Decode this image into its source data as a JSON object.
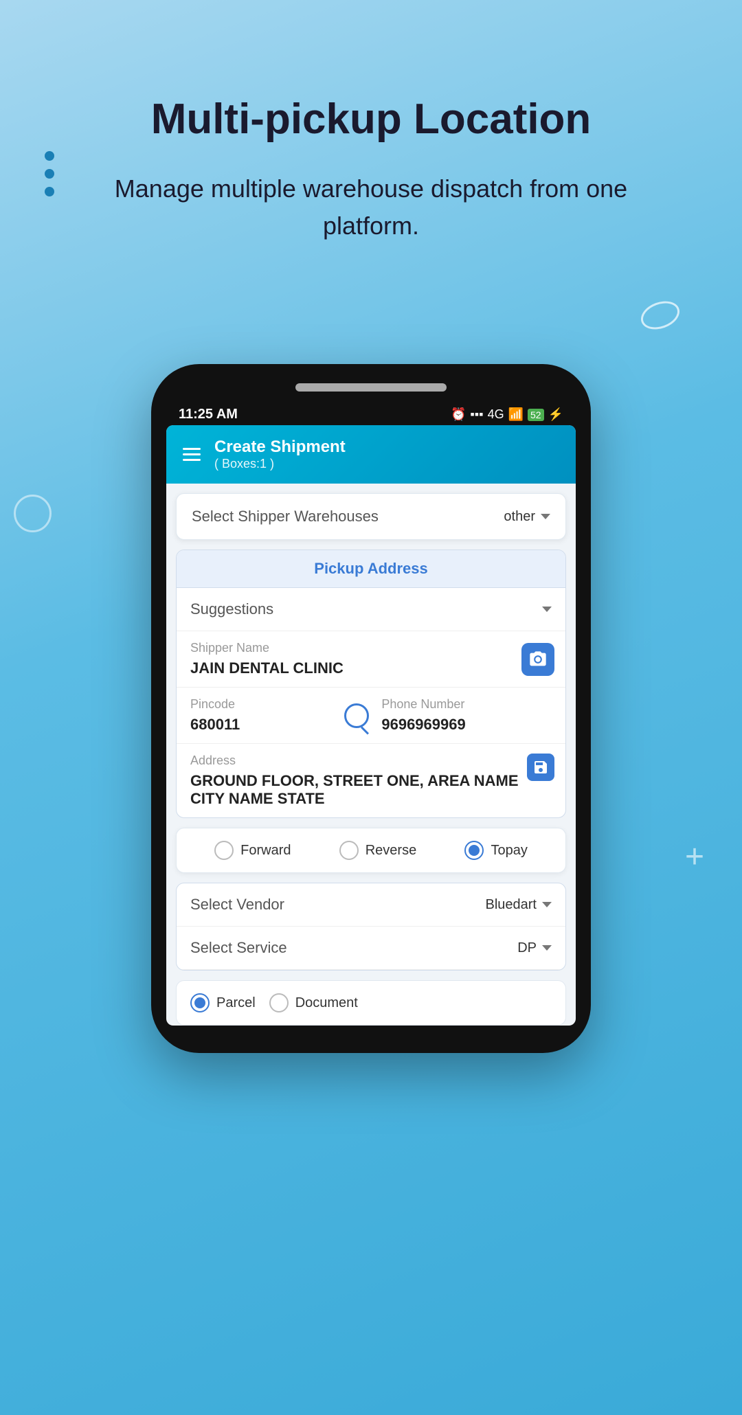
{
  "background": {
    "gradient_start": "#a8d8f0",
    "gradient_end": "#3aaad8"
  },
  "page": {
    "title": "Multi-pickup Location",
    "subtitle": "Manage multiple warehouse dispatch from one platform."
  },
  "phone": {
    "status_bar": {
      "time": "11:25 AM",
      "battery": "52",
      "signal": "4G"
    },
    "app_header": {
      "title": "Create Shipment",
      "subtitle": "( Boxes:1 )"
    },
    "warehouse_select": {
      "label": "Select Shipper Warehouses",
      "value": "other"
    },
    "pickup_section": {
      "header": "Pickup Address",
      "suggestions_label": "Suggestions",
      "shipper_name_label": "Shipper Name",
      "shipper_name_value": "JAIN DENTAL CLINIC",
      "pincode_label": "Pincode",
      "pincode_value": "680011",
      "phone_label": "Phone Number",
      "phone_value": "9696969969",
      "address_label": "Address",
      "address_value": "GROUND FLOOR, STREET ONE, AREA NAME CITY NAME STATE"
    },
    "shipment_types": [
      {
        "label": "Forward",
        "selected": false
      },
      {
        "label": "Reverse",
        "selected": false
      },
      {
        "label": "Topay",
        "selected": true
      }
    ],
    "vendor_section": {
      "vendor_label": "Select Vendor",
      "vendor_value": "Bluedart",
      "service_label": "Select Service",
      "service_value": "DP"
    },
    "parcel_types": [
      {
        "label": "Parcel",
        "selected": true
      },
      {
        "label": "Document",
        "selected": false
      }
    ]
  }
}
